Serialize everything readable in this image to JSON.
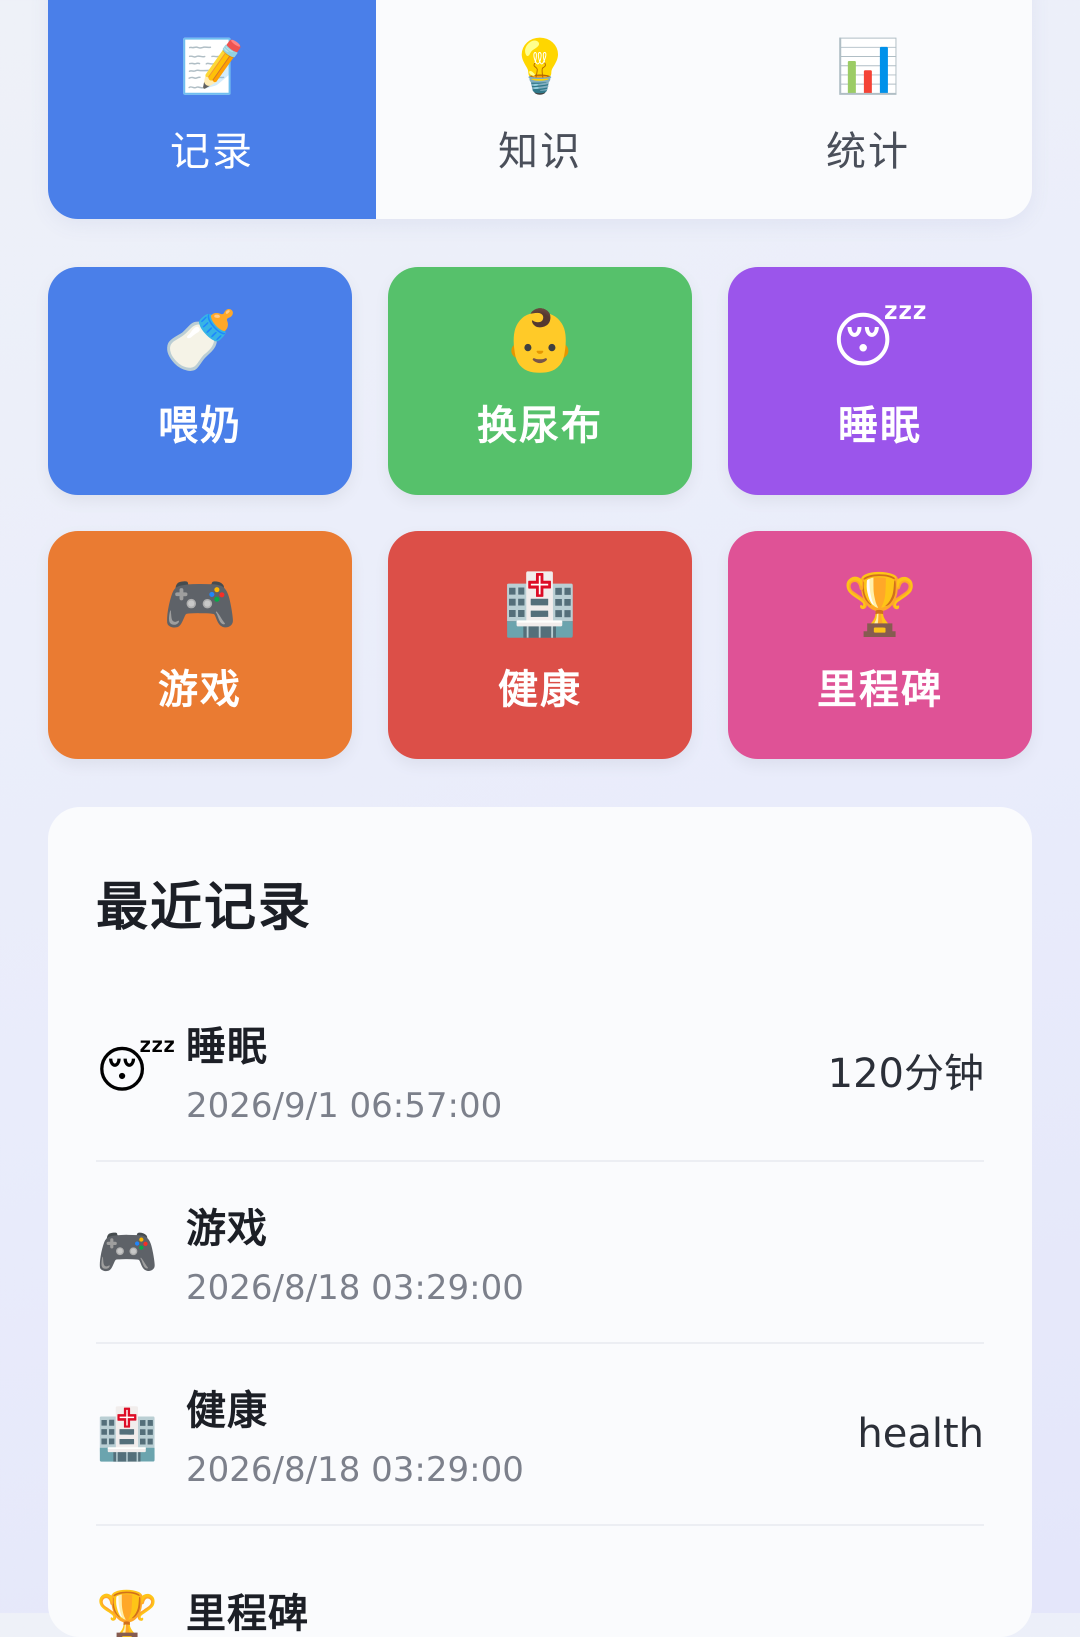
{
  "tabs": [
    {
      "icon": "memo-icon",
      "glyph": "📝",
      "label": "记录",
      "active": true
    },
    {
      "icon": "lightbulb-icon",
      "glyph": "💡",
      "label": "知识",
      "active": false
    },
    {
      "icon": "bar-chart-icon",
      "glyph": "📊",
      "label": "统计",
      "active": false
    }
  ],
  "actions": [
    {
      "icon": "baby-bottle-icon",
      "glyph": "🍼",
      "label": "喂奶",
      "color": "#4a7fe9"
    },
    {
      "icon": "baby-face-icon",
      "glyph": "👶",
      "label": "换尿布",
      "color": "#56c16b"
    },
    {
      "icon": "sleeping-face-icon",
      "glyph": "😴",
      "label": "睡眠",
      "color": "#9b55eb"
    },
    {
      "icon": "game-controller-icon",
      "glyph": "🎮",
      "label": "游戏",
      "color": "#ea7b32"
    },
    {
      "icon": "hospital-icon",
      "glyph": "🏥",
      "label": "健康",
      "color": "#dc4f48"
    },
    {
      "icon": "trophy-icon",
      "glyph": "🏆",
      "label": "里程碑",
      "color": "#df5296"
    }
  ],
  "recent": {
    "title": "最近记录",
    "items": [
      {
        "icon": "sleeping-face-icon",
        "glyph": "😴",
        "name": "睡眠",
        "time": "2026/9/1 06:57:00",
        "value": "120分钟"
      },
      {
        "icon": "game-controller-icon",
        "glyph": "🎮",
        "name": "游戏",
        "time": "2026/8/18 03:29:00",
        "value": ""
      },
      {
        "icon": "hospital-icon",
        "glyph": "🏥",
        "name": "健康",
        "time": "2026/8/18 03:29:00",
        "value": "health"
      },
      {
        "icon": "trophy-icon",
        "glyph": "🏆",
        "name": "里程碑",
        "time": "",
        "value": ""
      }
    ]
  }
}
